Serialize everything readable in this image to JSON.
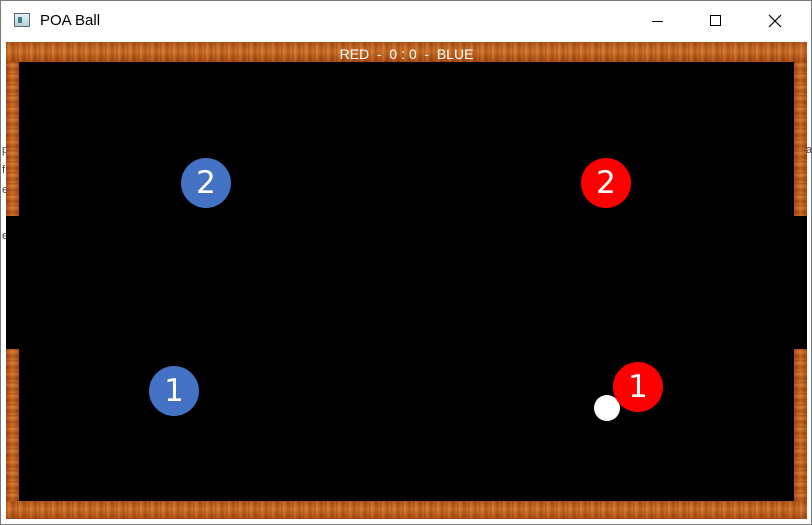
{
  "window": {
    "title": "POA Ball",
    "icon": "app-window-icon",
    "controls": [
      "minimize-icon",
      "maximize-icon",
      "close-icon"
    ]
  },
  "scoreboard": {
    "text": "RED  -  0 : 0  -  BLUE",
    "red_label": "RED",
    "red_score": 0,
    "blue_score": 0,
    "blue_label": "BLUE"
  },
  "players": {
    "blue": [
      {
        "number": "2"
      },
      {
        "number": "1"
      }
    ],
    "red": [
      {
        "number": "2"
      },
      {
        "number": "1"
      }
    ]
  },
  "colors": {
    "field": "#000000",
    "team_blue": "#4472c4",
    "team_red": "#ff0000",
    "ball": "#ffffff",
    "score_text": "#ffffff",
    "rail": "#c8692a"
  }
}
